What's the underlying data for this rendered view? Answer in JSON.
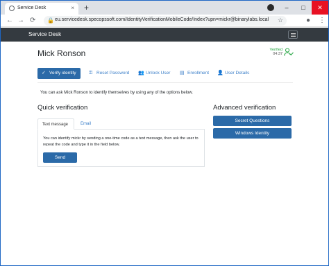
{
  "browser": {
    "tab_title": "Service Desk",
    "tab_close": "×",
    "new_tab": "+",
    "url": "eu.servicedesk.specopssoft.com/IdentityVerificationMobileCode/Index?upn=mickr@binarylabs.local",
    "controls": {
      "minimize": "–",
      "maximize": "□",
      "close": "✕"
    },
    "nav": {
      "back": "←",
      "forward": "→",
      "reload": "⟳",
      "menu": "⋮",
      "star": "☆",
      "lock": "🔒"
    }
  },
  "app": {
    "brand": "Service Desk"
  },
  "user": {
    "name": "Mick Ronson",
    "verified_label": "Verified",
    "verified_time": "04:37"
  },
  "nav_pills": [
    {
      "label": "Verify identity",
      "icon": "check-icon",
      "glyph": "✓"
    },
    {
      "label": "Reset Password",
      "icon": "key-icon",
      "glyph": "⚿"
    },
    {
      "label": "Unlock User",
      "icon": "users-icon",
      "glyph": "👥"
    },
    {
      "label": "Enrollment",
      "icon": "document-icon",
      "glyph": "▤"
    },
    {
      "label": "User Details",
      "icon": "user-icon",
      "glyph": "👤"
    }
  ],
  "intro_text": "You can ask Mick Ronson to identify themselves by using any of the options below.",
  "quick": {
    "heading": "Quick verification",
    "tabs": [
      "Text message",
      "Email"
    ],
    "panel_text": "You can identify mickr by sending a one-time code as a text message, then ask the user to repeat the code and type it in the field below.",
    "send_label": "Send"
  },
  "advanced": {
    "heading": "Advanced verification",
    "buttons": [
      "Secret Questions",
      "Windows Identity"
    ]
  },
  "colors": {
    "primary": "#2b6aa8",
    "header": "#343a40",
    "verified": "#28a745",
    "link": "#3a7ec8"
  }
}
